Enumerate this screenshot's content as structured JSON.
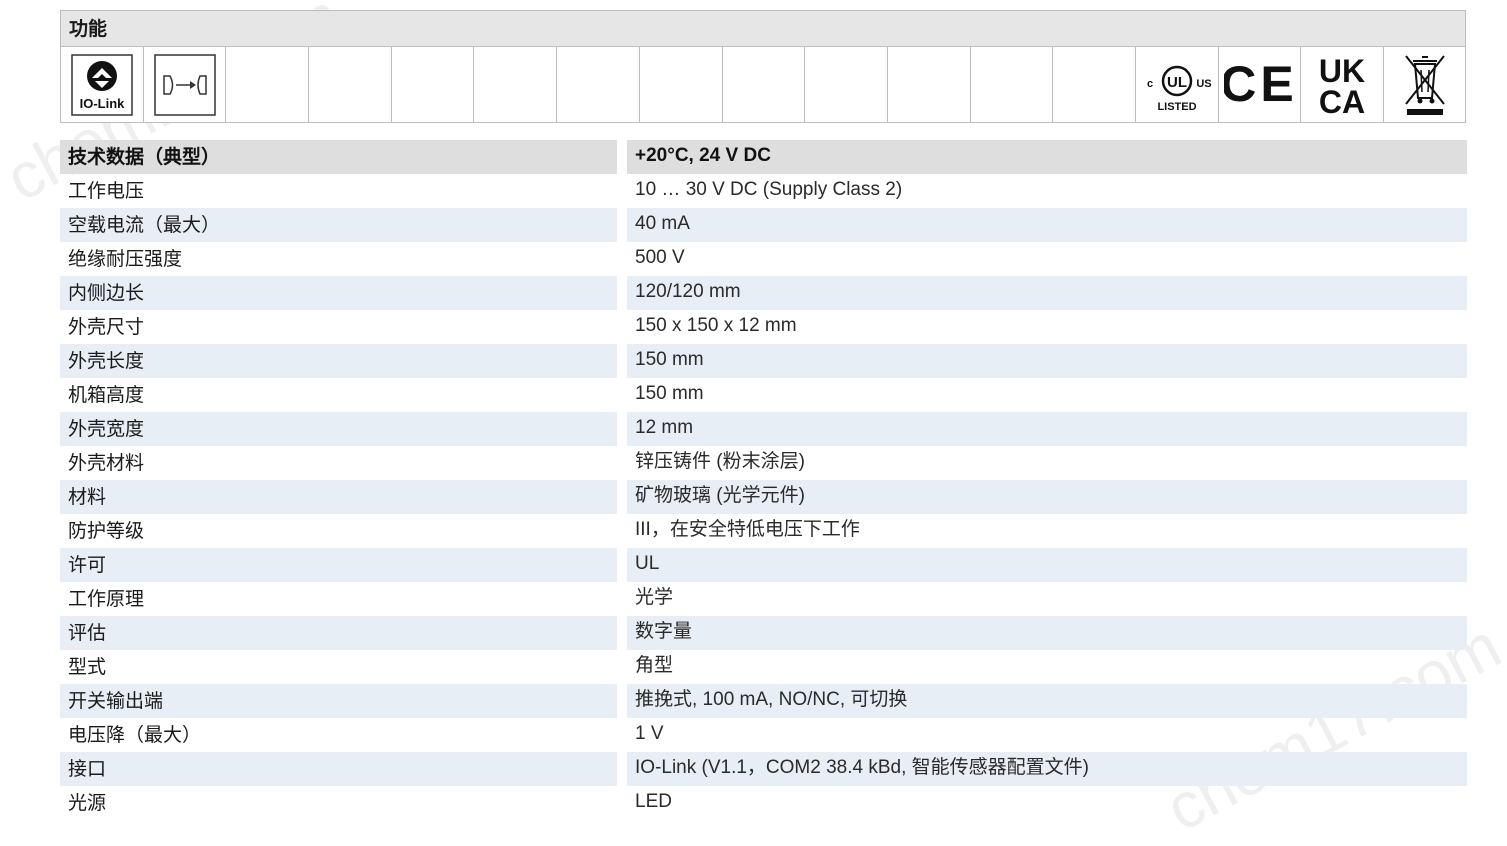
{
  "functions": {
    "title": "功能",
    "io_link_label": "IO-Link",
    "ul_text": {
      "c": "c",
      "ul": "UL",
      "us": "US",
      "listed": "LISTED"
    },
    "ce_text": "CE",
    "ukca_top": "UK",
    "ukca_bottom": "CA"
  },
  "spec_table": {
    "header": {
      "label": "技术数据（典型）",
      "value": "+20°C, 24 V DC"
    },
    "rows": [
      {
        "label": "工作电压",
        "value": "10 … 30 V DC (Supply Class 2)"
      },
      {
        "label": "空载电流（最大）",
        "value": "40 mA"
      },
      {
        "label": "绝缘耐压强度",
        "value": "500 V"
      },
      {
        "label": "内侧边长",
        "value": "120/120 mm"
      },
      {
        "label": "外壳尺寸",
        "value": "150 x 150 x 12 mm"
      },
      {
        "label": "外壳长度",
        "value": "150 mm"
      },
      {
        "label": "机箱高度",
        "value": "150 mm"
      },
      {
        "label": "外壳宽度",
        "value": "12 mm"
      },
      {
        "label": "外壳材料",
        "value": "锌压铸件 (粉末涂层)"
      },
      {
        "label": "材料",
        "value": "矿物玻璃 (光学元件)"
      },
      {
        "label": "防护等级",
        "value": "III，在安全特低电压下工作"
      },
      {
        "label": "许可",
        "value": "UL"
      },
      {
        "label": "工作原理",
        "value": "光学"
      },
      {
        "label": "评估",
        "value": "数字量"
      },
      {
        "label": "型式",
        "value": "角型"
      },
      {
        "label": "开关输出端",
        "value": "推挽式, 100 mA, NO/NC, 可切换"
      },
      {
        "label": "电压降（最大）",
        "value": "1 V"
      },
      {
        "label": "接口",
        "value": "IO-Link (V1.1，COM2 38.4 kBd, 智能传感器配置文件)"
      },
      {
        "label": "光源",
        "value": "LED"
      }
    ]
  },
  "watermark": {
    "text": "chem17.com"
  }
}
